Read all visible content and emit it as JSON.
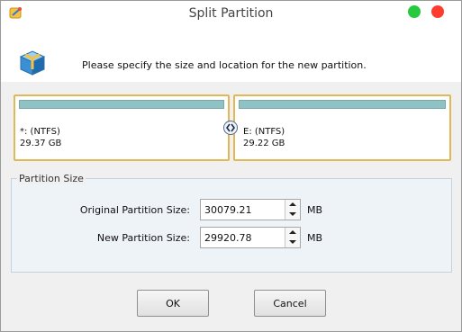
{
  "window": {
    "title": "Split Partition"
  },
  "icons": {
    "app": "minitool-app-icon",
    "wizard": "partition-wizard-icon",
    "split": "split-arrows-icon"
  },
  "instruction": "Please specify the size and location for the new partition.",
  "partitions": [
    {
      "name": "*: (NTFS)",
      "size": "29.37 GB"
    },
    {
      "name": "E: (NTFS)",
      "size": "29.22 GB"
    }
  ],
  "partition_size": {
    "group_title": "Partition Size",
    "original": {
      "label": "Original Partition Size:",
      "value": "30079.21",
      "unit": "MB"
    },
    "new": {
      "label": "New Partition Size:",
      "value": "29920.78",
      "unit": "MB"
    }
  },
  "buttons": {
    "ok": "OK",
    "cancel": "Cancel"
  },
  "colors": {
    "partition_border": "#e2b756",
    "partition_bar": "#8fc2c4",
    "close_button": "#ff3b30",
    "maximize_button": "#27c93f"
  }
}
